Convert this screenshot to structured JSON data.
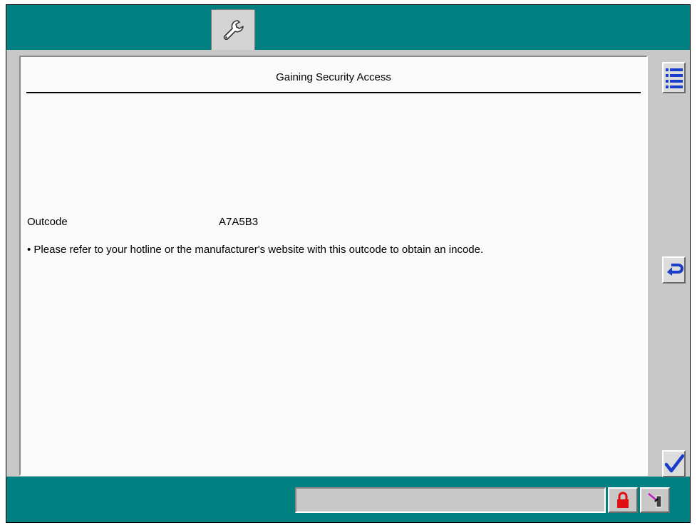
{
  "header": {
    "tab_icon": "wrench-icon"
  },
  "content": {
    "title": "Gaining Security Access",
    "outcode_label": "Outcode",
    "outcode_value": "A7A5B3",
    "instruction": "• Please refer to your hotline or the manufacturer's website with this outcode to obtain an incode."
  },
  "sidebar": {
    "buttons": [
      {
        "icon": "menu-list-icon"
      },
      {
        "icon": "return-arrow-icon"
      },
      {
        "icon": "checkmark-icon"
      }
    ]
  },
  "status_bar": {
    "status_text": "",
    "icons": [
      "lock-icon",
      "connection-icon"
    ]
  },
  "colors": {
    "frame": "#008080",
    "panel": "#c8c8c8",
    "accent_blue": "#1a3cc8",
    "lock_red": "#e01010"
  }
}
